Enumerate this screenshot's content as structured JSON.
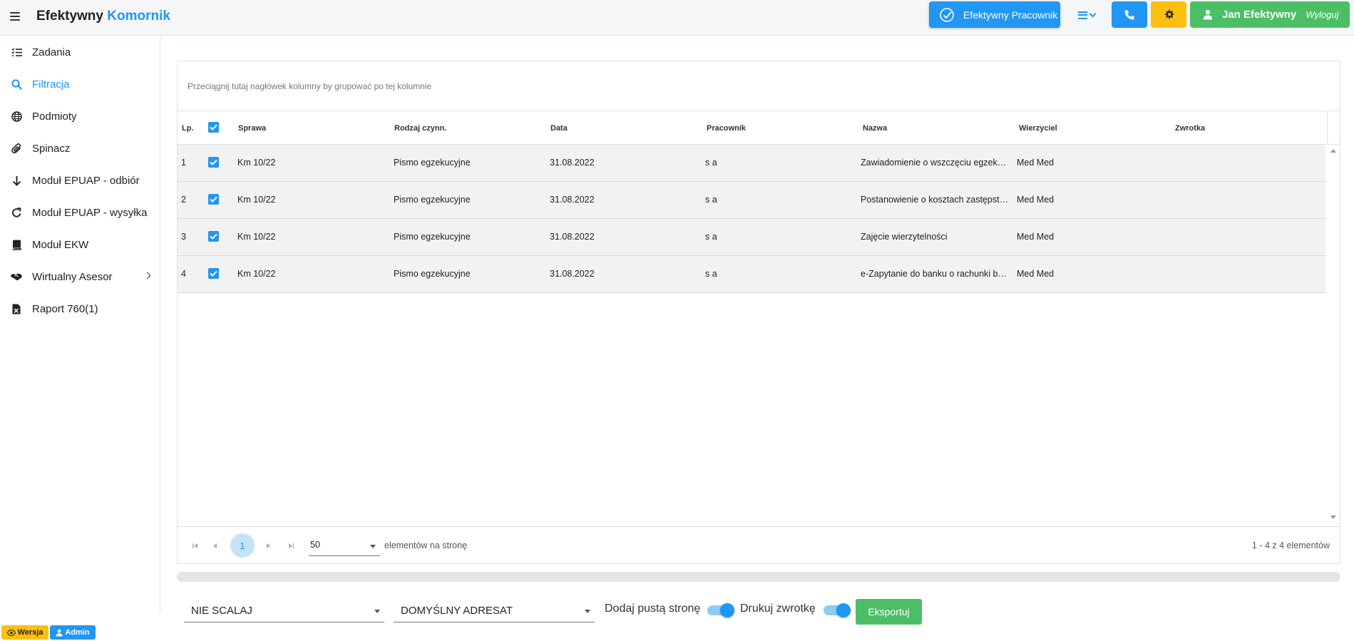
{
  "header": {
    "brand_part1": "Efektywny",
    "brand_part2": "Komornik",
    "worker_button": "Efektywny Pracownik",
    "user_name": "Jan Efektywny",
    "logout_label": "Wyloguj"
  },
  "sidebar": {
    "items": [
      {
        "label": "Zadania",
        "icon": "list-check-icon"
      },
      {
        "label": "Filtracja",
        "icon": "search-icon"
      },
      {
        "label": "Podmioty",
        "icon": "globe-icon"
      },
      {
        "label": "Spinacz",
        "icon": "paperclip-icon"
      },
      {
        "label": "Moduł EPUAP - odbiór",
        "icon": "arrow-down-icon"
      },
      {
        "label": "Moduł EPUAP - wysyłka",
        "icon": "refresh-icon"
      },
      {
        "label": "Moduł EKW",
        "icon": "book-icon"
      },
      {
        "label": "Wirtualny Asesor",
        "icon": "handshake-icon"
      },
      {
        "label": "Raport 760(1)",
        "icon": "excel-file-icon"
      }
    ]
  },
  "badges": {
    "wersja": "Wersja",
    "admin": "Admin"
  },
  "grid": {
    "group_hint": "Przeciągnij tutaj nagłówek kolumny by grupować po tej kolumnie",
    "columns": {
      "lp": "Lp.",
      "sprawa": "Sprawa",
      "rodzaj": "Rodzaj czynn.",
      "data": "Data",
      "pracownik": "Pracownik",
      "nazwa": "Nazwa",
      "wierzyciel": "Wierzyciel",
      "zwrotka": "Zwrotka"
    },
    "rows": [
      {
        "lp": "1",
        "sprawa": "Km 10/22",
        "rodzaj": "Pismo egzekucyjne",
        "data": "31.08.2022",
        "pracownik": "s a",
        "nazwa": "Zawiadomienie o wszczęciu egzekucji",
        "wierzyciel": "Med Med",
        "zwrotka": ""
      },
      {
        "lp": "2",
        "sprawa": "Km 10/22",
        "rodzaj": "Pismo egzekucyjne",
        "data": "31.08.2022",
        "pracownik": "s a",
        "nazwa": "Postanowienie o kosztach zastępstwa",
        "wierzyciel": "Med Med",
        "zwrotka": ""
      },
      {
        "lp": "3",
        "sprawa": "Km 10/22",
        "rodzaj": "Pismo egzekucyjne",
        "data": "31.08.2022",
        "pracownik": "s a",
        "nazwa": "Zajęcie wierzytelności",
        "wierzyciel": "Med Med",
        "zwrotka": ""
      },
      {
        "lp": "4",
        "sprawa": "Km 10/22",
        "rodzaj": "Pismo egzekucyjne",
        "data": "31.08.2022",
        "pracownik": "s a",
        "nazwa": "e-Zapytanie do banku o rachunki bankowe",
        "wierzyciel": "Med Med",
        "zwrotka": ""
      }
    ],
    "pager": {
      "current_page": "1",
      "page_size": "50",
      "page_size_label": "elementów na stronę",
      "info": "1 - 4 z 4 elementów"
    }
  },
  "bottom": {
    "merge_select": "NIE SCALAJ",
    "addressee_select": "DOMYŚLNY ADRESAT",
    "blank_page_label": "Dodaj pustą stronę",
    "print_return_label": "Drukuj zwrotkę",
    "export_button": "Eksportuj"
  },
  "colors": {
    "primary": "#2196f3",
    "warning": "#fdc010",
    "success": "#4cbe66"
  }
}
